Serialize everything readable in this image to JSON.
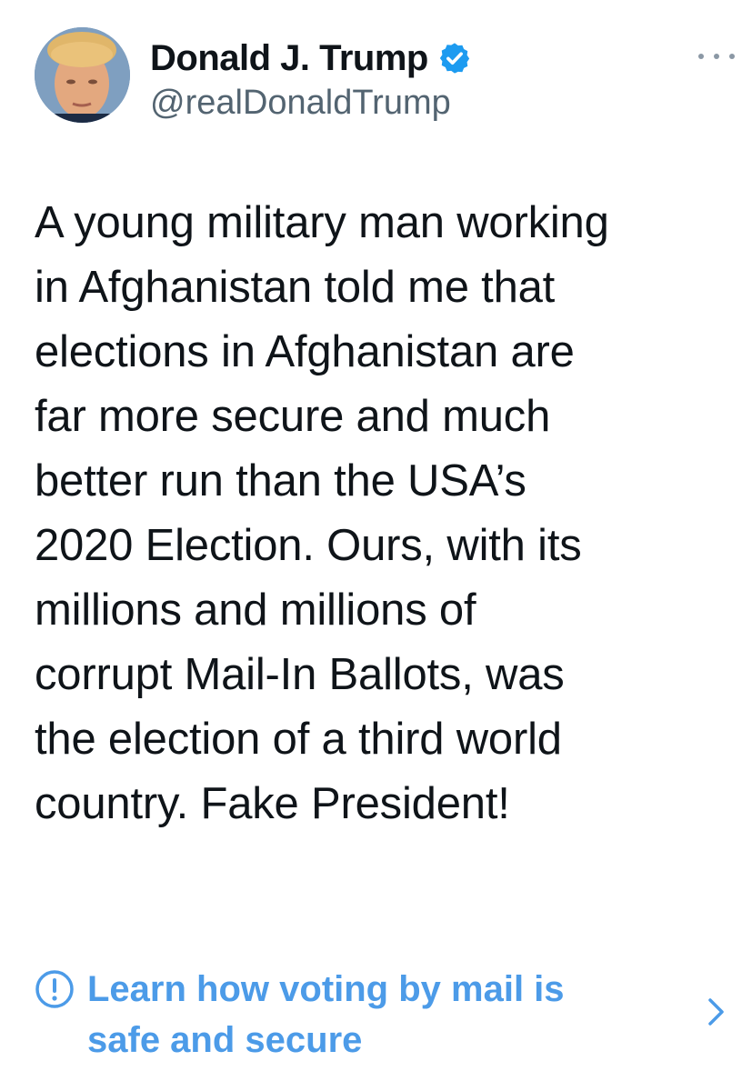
{
  "tweet": {
    "display_name": "Donald J. Trump",
    "handle": "@realDonaldTrump",
    "verified_icon": "verified-badge-icon",
    "more_icon": "more-options-icon",
    "text": "A young military man working\nin Afghanistan told me that\nelections in Afghanistan are\nfar more secure and much\nbetter run than the USA’s\n2020 Election. Ours, with its\nmillions and millions of\ncorrupt Mail-In Ballots, was\nthe election of a third world\ncountry. Fake President!",
    "notice": {
      "icon": "exclamation-circle-icon",
      "text": "Learn how voting by mail is\nsafe and secure",
      "chevron_icon": "chevron-right-icon"
    }
  },
  "colors": {
    "text": "#0f1419",
    "secondary_text": "#536471",
    "link_blue": "#4c9be8",
    "verified_blue": "#1d9bf0",
    "background": "#ffffff"
  }
}
